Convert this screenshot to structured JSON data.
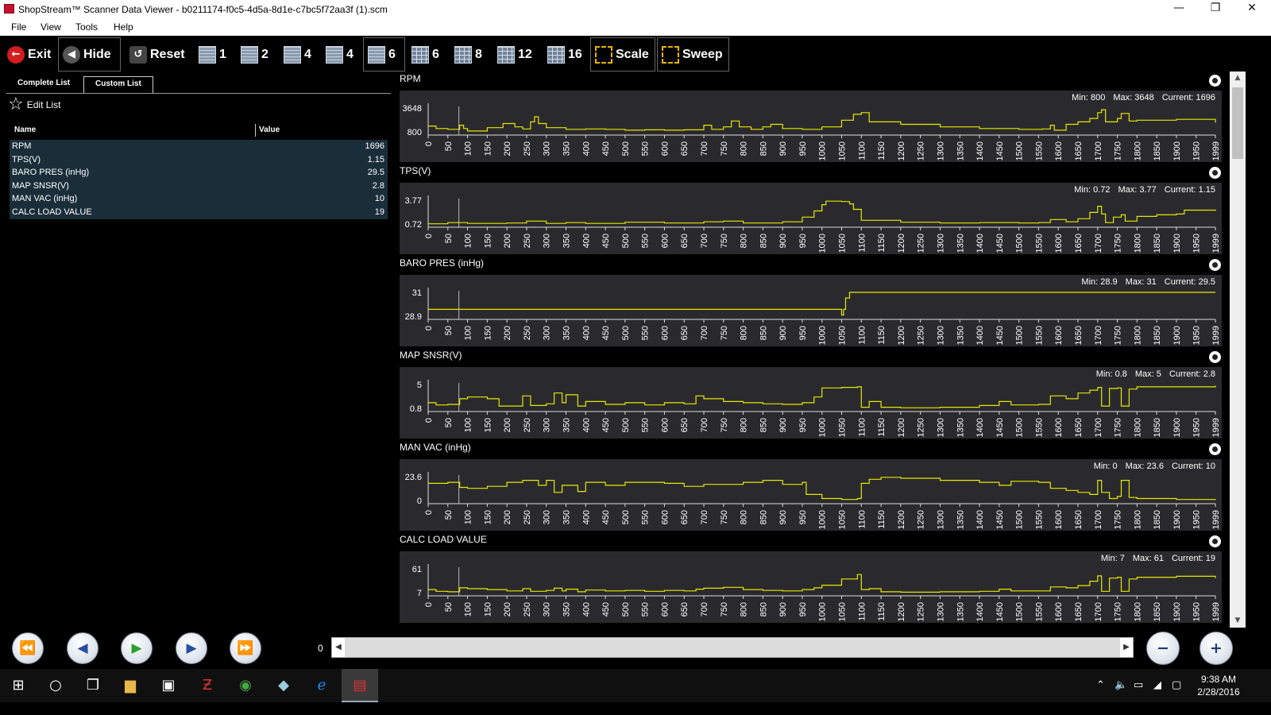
{
  "window": {
    "title": "ShopStream™ Scanner Data Viewer - b0211174-f0c5-4d5a-8d1e-c7bc5f72aa3f (1).scm",
    "minimize": "—",
    "maximize": "❐",
    "close": "✕"
  },
  "menu": [
    "File",
    "View",
    "Tools",
    "Help"
  ],
  "toolbar": {
    "exit": "Exit",
    "hide": "Hide",
    "reset": "Reset",
    "layouts": [
      "1",
      "2",
      "4",
      "4",
      "6",
      "6",
      "8",
      "12",
      "16"
    ],
    "selected_layout_index": 4,
    "scale": "Scale",
    "sweep": "Sweep"
  },
  "left_pane": {
    "tabs": [
      "Complete List",
      "Custom List"
    ],
    "active_tab": "Custom List",
    "edit_list": "Edit List",
    "col_name": "Name",
    "col_value": "Value",
    "rows": [
      {
        "name": "RPM",
        "value": "1696"
      },
      {
        "name": "TPS(V)",
        "value": "1.15"
      },
      {
        "name": "BARO PRES (inHg)",
        "value": "29.5"
      },
      {
        "name": "MAP SNSR(V)",
        "value": "2.8"
      },
      {
        "name": "MAN VAC (inHg)",
        "value": "10"
      },
      {
        "name": "CALC LOAD VALUE",
        "value": "19"
      }
    ]
  },
  "charts": [
    {
      "title": "RPM",
      "min_text": "Min: 800",
      "max_text": "Max: 3648",
      "current_text": "Current: 1696",
      "ymin_label": "800",
      "ymax_label": "3648",
      "ymin": 800,
      "ymax": 3648,
      "points": [
        [
          0,
          1500
        ],
        [
          20,
          1200
        ],
        [
          50,
          1100
        ],
        [
          75,
          1100
        ],
        [
          80,
          1600
        ],
        [
          90,
          1200
        ],
        [
          100,
          900
        ],
        [
          150,
          1300
        ],
        [
          190,
          1800
        ],
        [
          220,
          1400
        ],
        [
          240,
          1150
        ],
        [
          260,
          2000
        ],
        [
          270,
          2600
        ],
        [
          280,
          1800
        ],
        [
          300,
          1300
        ],
        [
          350,
          1100
        ],
        [
          400,
          1150
        ],
        [
          450,
          1100
        ],
        [
          500,
          1000
        ],
        [
          550,
          1050
        ],
        [
          600,
          1000
        ],
        [
          650,
          1050
        ],
        [
          700,
          1600
        ],
        [
          720,
          1100
        ],
        [
          750,
          1400
        ],
        [
          770,
          2100
        ],
        [
          790,
          1400
        ],
        [
          820,
          1100
        ],
        [
          850,
          1400
        ],
        [
          870,
          1700
        ],
        [
          900,
          1200
        ],
        [
          950,
          1100
        ],
        [
          1000,
          1400
        ],
        [
          1050,
          2200
        ],
        [
          1080,
          2900
        ],
        [
          1100,
          3100
        ],
        [
          1120,
          2000
        ],
        [
          1200,
          1700
        ],
        [
          1300,
          1400
        ],
        [
          1400,
          1200
        ],
        [
          1500,
          1100
        ],
        [
          1560,
          1150
        ],
        [
          1580,
          1600
        ],
        [
          1590,
          1000
        ],
        [
          1620,
          1700
        ],
        [
          1650,
          2000
        ],
        [
          1680,
          2400
        ],
        [
          1700,
          3100
        ],
        [
          1710,
          3450
        ],
        [
          1720,
          2000
        ],
        [
          1750,
          2400
        ],
        [
          1760,
          3000
        ],
        [
          1780,
          2100
        ],
        [
          1800,
          2200
        ],
        [
          1900,
          2300
        ],
        [
          1999,
          1900
        ]
      ]
    },
    {
      "title": "TPS(V)",
      "min_text": "Min: 0.72",
      "max_text": "Max: 3.77",
      "current_text": "Current: 1.15",
      "ymin_label": "0.72",
      "ymax_label": "3.77",
      "ymin": 0.72,
      "ymax": 3.77,
      "points": [
        [
          0,
          0.75
        ],
        [
          50,
          0.9
        ],
        [
          100,
          0.8
        ],
        [
          200,
          0.85
        ],
        [
          250,
          1.1
        ],
        [
          300,
          0.8
        ],
        [
          350,
          0.9
        ],
        [
          400,
          0.8
        ],
        [
          500,
          0.95
        ],
        [
          600,
          0.85
        ],
        [
          700,
          1.0
        ],
        [
          750,
          1.1
        ],
        [
          800,
          0.85
        ],
        [
          900,
          1.0
        ],
        [
          950,
          1.6
        ],
        [
          980,
          2.4
        ],
        [
          1000,
          3.2
        ],
        [
          1010,
          3.65
        ],
        [
          1050,
          3.6
        ],
        [
          1070,
          3.3
        ],
        [
          1080,
          2.6
        ],
        [
          1100,
          1.2
        ],
        [
          1200,
          0.95
        ],
        [
          1300,
          0.85
        ],
        [
          1400,
          0.9
        ],
        [
          1500,
          0.85
        ],
        [
          1550,
          0.9
        ],
        [
          1580,
          1.3
        ],
        [
          1620,
          1.0
        ],
        [
          1650,
          1.4
        ],
        [
          1680,
          2.2
        ],
        [
          1700,
          3.0
        ],
        [
          1710,
          2.0
        ],
        [
          1720,
          0.9
        ],
        [
          1740,
          1.6
        ],
        [
          1760,
          1.9
        ],
        [
          1770,
          1.1
        ],
        [
          1800,
          1.7
        ],
        [
          1850,
          1.9
        ],
        [
          1900,
          2.0
        ],
        [
          1920,
          2.5
        ],
        [
          1999,
          2.4
        ]
      ]
    },
    {
      "title": "BARO PRES (inHg)",
      "min_text": "Min: 28.9",
      "max_text": "Max: 31",
      "current_text": "Current: 29.5",
      "ymin_label": "28.9",
      "ymax_label": "31",
      "ymin": 28.9,
      "ymax": 31,
      "points": [
        [
          0,
          29.5
        ],
        [
          1020,
          29.5
        ],
        [
          1050,
          29.0
        ],
        [
          1055,
          29.5
        ],
        [
          1060,
          30.5
        ],
        [
          1070,
          31
        ],
        [
          1999,
          31
        ]
      ]
    },
    {
      "title": "MAP SNSR(V)",
      "min_text": "Min: 0.8",
      "max_text": "Max: 5",
      "current_text": "Current: 2.8",
      "ymin_label": "0.8",
      "ymax_label": "5",
      "ymin": 0.8,
      "ymax": 5,
      "points": [
        [
          0,
          1.8
        ],
        [
          20,
          1.4
        ],
        [
          50,
          1.5
        ],
        [
          80,
          2.5
        ],
        [
          100,
          2.8
        ],
        [
          150,
          2.5
        ],
        [
          180,
          1.2
        ],
        [
          240,
          3.0
        ],
        [
          260,
          1.3
        ],
        [
          300,
          1.6
        ],
        [
          320,
          3.5
        ],
        [
          340,
          1.8
        ],
        [
          350,
          3.2
        ],
        [
          380,
          1.2
        ],
        [
          400,
          2.0
        ],
        [
          450,
          1.5
        ],
        [
          500,
          1.8
        ],
        [
          550,
          1.4
        ],
        [
          600,
          1.8
        ],
        [
          650,
          1.6
        ],
        [
          680,
          3.0
        ],
        [
          700,
          2.5
        ],
        [
          750,
          2.0
        ],
        [
          800,
          1.8
        ],
        [
          850,
          1.6
        ],
        [
          900,
          1.5
        ],
        [
          950,
          1.8
        ],
        [
          980,
          2.8
        ],
        [
          1000,
          4.4
        ],
        [
          1050,
          4.5
        ],
        [
          1090,
          4.6
        ],
        [
          1100,
          1.0
        ],
        [
          1120,
          2.0
        ],
        [
          1150,
          1.0
        ],
        [
          1200,
          0.9
        ],
        [
          1300,
          1.0
        ],
        [
          1400,
          1.3
        ],
        [
          1450,
          2.0
        ],
        [
          1480,
          1.4
        ],
        [
          1550,
          1.5
        ],
        [
          1580,
          3.0
        ],
        [
          1620,
          2.5
        ],
        [
          1650,
          3.5
        ],
        [
          1680,
          4.0
        ],
        [
          1700,
          4.5
        ],
        [
          1710,
          1.2
        ],
        [
          1730,
          4.3
        ],
        [
          1750,
          4.4
        ],
        [
          1760,
          1.2
        ],
        [
          1780,
          4.2
        ],
        [
          1800,
          4.6
        ],
        [
          1999,
          4.8
        ]
      ]
    },
    {
      "title": "MAN VAC (inHg)",
      "min_text": "Min: 0",
      "max_text": "Max: 23.6",
      "current_text": "Current: 10",
      "ymin_label": "0",
      "ymax_label": "23.6",
      "ymin": 0,
      "ymax": 23.6,
      "points": [
        [
          0,
          17
        ],
        [
          50,
          18
        ],
        [
          80,
          13
        ],
        [
          100,
          12
        ],
        [
          150,
          14
        ],
        [
          200,
          18
        ],
        [
          240,
          20
        ],
        [
          280,
          15
        ],
        [
          300,
          20
        ],
        [
          320,
          8
        ],
        [
          340,
          15
        ],
        [
          380,
          9
        ],
        [
          400,
          18
        ],
        [
          450,
          15
        ],
        [
          500,
          18
        ],
        [
          600,
          17
        ],
        [
          650,
          14
        ],
        [
          700,
          16
        ],
        [
          750,
          16
        ],
        [
          800,
          18
        ],
        [
          850,
          20
        ],
        [
          900,
          16
        ],
        [
          950,
          18
        ],
        [
          960,
          6
        ],
        [
          1000,
          2
        ],
        [
          1050,
          1
        ],
        [
          1090,
          2
        ],
        [
          1100,
          17
        ],
        [
          1120,
          21
        ],
        [
          1150,
          23
        ],
        [
          1200,
          22
        ],
        [
          1300,
          20
        ],
        [
          1400,
          18
        ],
        [
          1450,
          15
        ],
        [
          1480,
          19
        ],
        [
          1550,
          18
        ],
        [
          1580,
          12
        ],
        [
          1620,
          10
        ],
        [
          1650,
          8
        ],
        [
          1680,
          6
        ],
        [
          1700,
          20
        ],
        [
          1710,
          8
        ],
        [
          1730,
          2
        ],
        [
          1750,
          4
        ],
        [
          1760,
          20
        ],
        [
          1780,
          3
        ],
        [
          1800,
          2
        ],
        [
          1900,
          1
        ],
        [
          1999,
          0.5
        ]
      ]
    },
    {
      "title": "CALC LOAD VALUE",
      "min_text": "Min: 7",
      "max_text": "Max: 61",
      "current_text": "Current: 19",
      "ymin_label": "7",
      "ymax_label": "61",
      "ymin": 7,
      "ymax": 61,
      "points": [
        [
          0,
          14
        ],
        [
          20,
          10
        ],
        [
          50,
          9
        ],
        [
          80,
          18
        ],
        [
          100,
          16
        ],
        [
          150,
          14
        ],
        [
          200,
          11
        ],
        [
          240,
          16
        ],
        [
          260,
          10
        ],
        [
          300,
          12
        ],
        [
          320,
          17
        ],
        [
          340,
          11
        ],
        [
          350,
          15
        ],
        [
          380,
          9
        ],
        [
          400,
          13
        ],
        [
          450,
          11
        ],
        [
          500,
          12
        ],
        [
          550,
          10
        ],
        [
          600,
          12
        ],
        [
          650,
          11
        ],
        [
          680,
          15
        ],
        [
          700,
          17
        ],
        [
          750,
          19
        ],
        [
          800,
          14
        ],
        [
          850,
          12
        ],
        [
          900,
          11
        ],
        [
          950,
          14
        ],
        [
          980,
          18
        ],
        [
          1000,
          24
        ],
        [
          1050,
          38
        ],
        [
          1090,
          48
        ],
        [
          1100,
          14
        ],
        [
          1120,
          16
        ],
        [
          1150,
          9
        ],
        [
          1200,
          8
        ],
        [
          1300,
          9
        ],
        [
          1400,
          10
        ],
        [
          1450,
          15
        ],
        [
          1480,
          11
        ],
        [
          1550,
          11
        ],
        [
          1580,
          20
        ],
        [
          1620,
          18
        ],
        [
          1650,
          23
        ],
        [
          1680,
          33
        ],
        [
          1700,
          45
        ],
        [
          1710,
          10
        ],
        [
          1730,
          40
        ],
        [
          1750,
          42
        ],
        [
          1760,
          10
        ],
        [
          1780,
          38
        ],
        [
          1800,
          42
        ],
        [
          1900,
          44
        ],
        [
          1999,
          40
        ]
      ]
    }
  ],
  "x_ticks": [
    "0",
    "50",
    "100",
    "150",
    "200",
    "250",
    "300",
    "350",
    "400",
    "450",
    "500",
    "550",
    "600",
    "650",
    "700",
    "750",
    "800",
    "850",
    "900",
    "950",
    "1000",
    "1050",
    "1100",
    "1150",
    "1200",
    "1250",
    "1300",
    "1350",
    "1400",
    "1450",
    "1500",
    "1550",
    "1600",
    "1650",
    "1700",
    "1750",
    "1800",
    "1850",
    "1900",
    "1950",
    "1999"
  ],
  "playback": {
    "position": "0",
    "buttons": [
      "rewind",
      "step-back",
      "play",
      "step-forward",
      "fast-forward"
    ]
  },
  "taskbar": {
    "time": "9:38 AM",
    "date": "2/28/2016"
  },
  "colors": {
    "trace": "#e6e600",
    "panel": "#2a2a2e",
    "list_bg": "#1a2e3a"
  }
}
